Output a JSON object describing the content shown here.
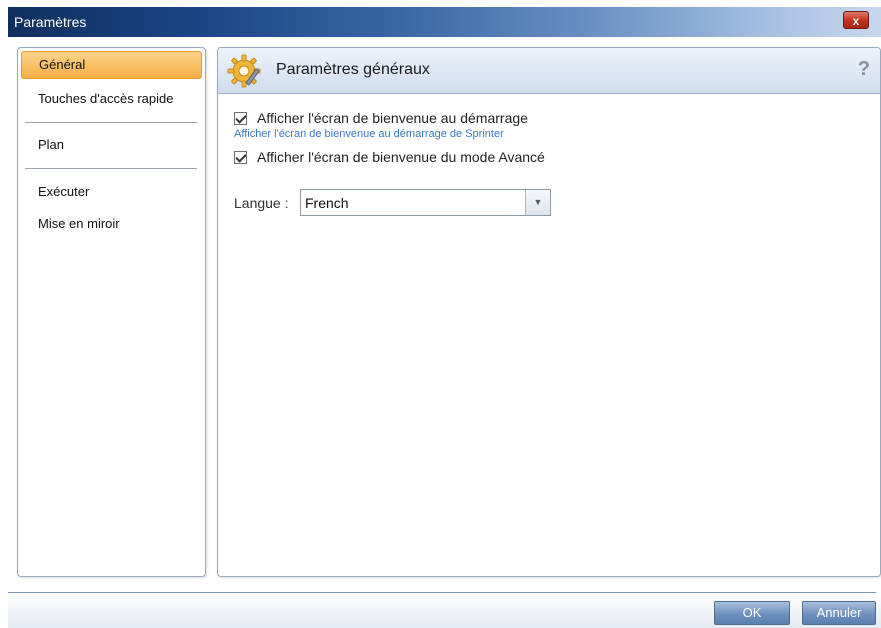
{
  "window": {
    "title": "Paramètres",
    "close_label": "x"
  },
  "sidebar": {
    "items": [
      {
        "label": "Général",
        "active": true
      },
      {
        "label": "Touches d'accès rapide"
      },
      {
        "label": "Plan"
      },
      {
        "label": "Exécuter"
      },
      {
        "label": "Mise en miroir"
      }
    ]
  },
  "panel": {
    "icon": "gear-wrench-icon",
    "title": "Paramètres généraux",
    "help_label": "?",
    "options": [
      {
        "label": "Afficher l'écran de bienvenue au démarrage",
        "checked": true,
        "hint": "Afficher l'écran de bienvenue au démarrage de Sprinter"
      },
      {
        "label": "Afficher l'écran de bienvenue du mode Avancé",
        "checked": true
      }
    ],
    "language": {
      "label": "Langue :",
      "value": "French"
    }
  },
  "footer": {
    "ok_label": "OK",
    "cancel_label": "Annuler"
  },
  "colors": {
    "active_item": "#f6ad45",
    "hint_text": "#3b78c4",
    "button": "#6f91bd"
  }
}
